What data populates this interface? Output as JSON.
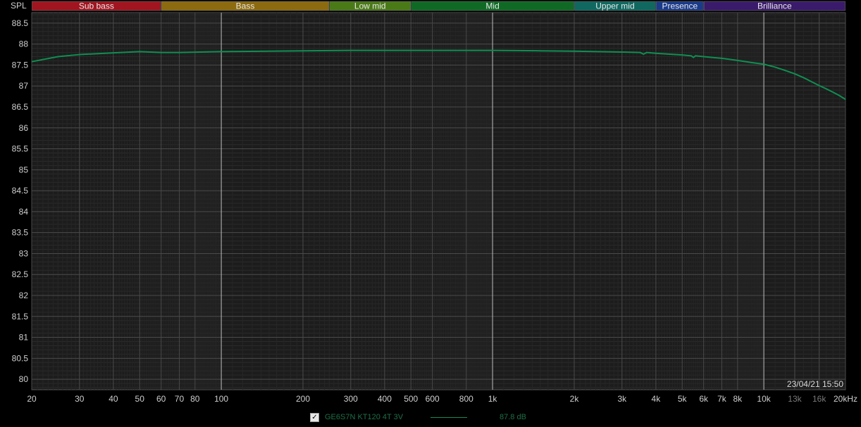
{
  "chart_data": {
    "type": "line",
    "ylabel": "SPL",
    "xscale": "log",
    "xlim": [
      20,
      20000
    ],
    "ylim": [
      79.75,
      88.75
    ],
    "grid": true,
    "x_ticks": [
      {
        "value": 20,
        "label": "20"
      },
      {
        "value": 30,
        "label": "30"
      },
      {
        "value": 40,
        "label": "40"
      },
      {
        "value": 50,
        "label": "50"
      },
      {
        "value": 60,
        "label": "60"
      },
      {
        "value": 70,
        "label": "70"
      },
      {
        "value": 80,
        "label": "80"
      },
      {
        "value": 100,
        "label": "100"
      },
      {
        "value": 200,
        "label": "200"
      },
      {
        "value": 300,
        "label": "300"
      },
      {
        "value": 400,
        "label": "400"
      },
      {
        "value": 500,
        "label": "500"
      },
      {
        "value": 600,
        "label": "600"
      },
      {
        "value": 800,
        "label": "800"
      },
      {
        "value": 1000,
        "label": "1k"
      },
      {
        "value": 2000,
        "label": "2k"
      },
      {
        "value": 3000,
        "label": "3k"
      },
      {
        "value": 4000,
        "label": "4k"
      },
      {
        "value": 5000,
        "label": "5k"
      },
      {
        "value": 6000,
        "label": "6k"
      },
      {
        "value": 7000,
        "label": "7k"
      },
      {
        "value": 8000,
        "label": "8k"
      },
      {
        "value": 10000,
        "label": "10k"
      },
      {
        "value": 13000,
        "label": "13k"
      },
      {
        "value": 16000,
        "label": "16k"
      },
      {
        "value": 20000,
        "label": "20kHz"
      }
    ],
    "y_ticks": [
      "88.5",
      "88",
      "87.5",
      "87",
      "86.5",
      "86",
      "85.5",
      "85",
      "84.5",
      "84",
      "83.5",
      "83",
      "82.5",
      "82",
      "81.5",
      "81",
      "80.5",
      "80"
    ],
    "bands": [
      {
        "label": "Sub bass",
        "from": 20,
        "to": 60,
        "color": "#a01520"
      },
      {
        "label": "Bass",
        "from": 60,
        "to": 250,
        "color": "#8c6a10"
      },
      {
        "label": "Low mid",
        "from": 250,
        "to": 500,
        "color": "#4a7a18"
      },
      {
        "label": "Mid",
        "from": 500,
        "to": 2000,
        "color": "#106a25"
      },
      {
        "label": "Upper mid",
        "from": 2000,
        "to": 4000,
        "color": "#106860"
      },
      {
        "label": "Presence",
        "from": 4000,
        "to": 6000,
        "color": "#1a3a8a"
      },
      {
        "label": "Brilliance",
        "from": 6000,
        "to": 20000,
        "color": "#3a1a6a"
      }
    ],
    "series": [
      {
        "name": "GE6S7N KT120 4T 3V",
        "color": "#0f8f52",
        "x": [
          20,
          25,
          30,
          40,
          50,
          60,
          70,
          100,
          200,
          300,
          500,
          700,
          1000,
          1500,
          2000,
          3000,
          3500,
          3600,
          3700,
          4000,
          5000,
          5400,
          5500,
          5600,
          6000,
          7000,
          8000,
          9000,
          10000,
          11000,
          12000,
          13000,
          14000,
          15000,
          16000,
          17000,
          18000,
          19000,
          20000
        ],
        "y": [
          87.58,
          87.7,
          87.75,
          87.79,
          87.82,
          87.8,
          87.8,
          87.82,
          87.84,
          87.85,
          87.85,
          87.85,
          87.85,
          87.84,
          87.83,
          87.81,
          87.8,
          87.76,
          87.8,
          87.78,
          87.74,
          87.72,
          87.68,
          87.72,
          87.7,
          87.66,
          87.61,
          87.56,
          87.52,
          87.45,
          87.37,
          87.29,
          87.2,
          87.1,
          87.01,
          86.93,
          86.85,
          86.77,
          86.68
        ]
      }
    ],
    "legend_value": "87.8 dB",
    "timestamp": "23/04/21 15:50"
  }
}
